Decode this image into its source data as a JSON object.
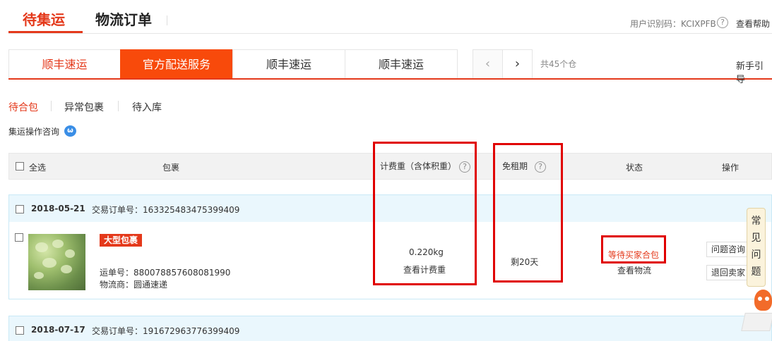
{
  "header": {
    "tab_pending": "待集运",
    "tab_logistics": "物流订单",
    "user_code": "用户识别码：KCIXPFB",
    "help_icon": "question-circle-icon",
    "help_link": "查看帮助"
  },
  "service_tabs": {
    "items": [
      "顺丰速运",
      "官方配送服务",
      "顺丰速运",
      "顺丰速运"
    ],
    "active_index": 1,
    "prev_icon": "chevron-left-icon",
    "next_icon": "chevron-right-icon",
    "count_text": "共45个仓",
    "guide": "新手引导"
  },
  "sub_tabs": {
    "items": [
      "待合包",
      "异常包裹",
      "待入库"
    ],
    "active_index": 0,
    "consult": "集运操作咨询",
    "consult_icon": "chat-bubble-icon"
  },
  "table": {
    "select_all": "全选",
    "col_package": "包裹",
    "col_weight": "计费重（含体积重）",
    "col_free": "免租期",
    "col_status": "状态",
    "col_action": "操作"
  },
  "orders": [
    {
      "date": "2018-05-21",
      "order_no": "交易订单号：163325483475399409",
      "badge": "大型包裹",
      "waybill": "运单号：880078857608081990",
      "carrier": "物流商：圆通速递",
      "weight": "0.220kg",
      "weight_link": "查看计费重",
      "free_days": "剩20天",
      "status": "等待买家合包",
      "status_link": "查看物流",
      "actions": [
        "问题咨询",
        "退回卖家"
      ]
    },
    {
      "date": "2018-07-17",
      "order_no": "交易订单号：191672963776399409"
    }
  ],
  "faq": {
    "chars": [
      "常",
      "见",
      "问",
      "题"
    ]
  },
  "colors": {
    "accent": "#e4391b",
    "active_tab_bg": "#f84a0b",
    "order_header_bg": "#eaf7fd",
    "annotation_red": "#e00000"
  }
}
